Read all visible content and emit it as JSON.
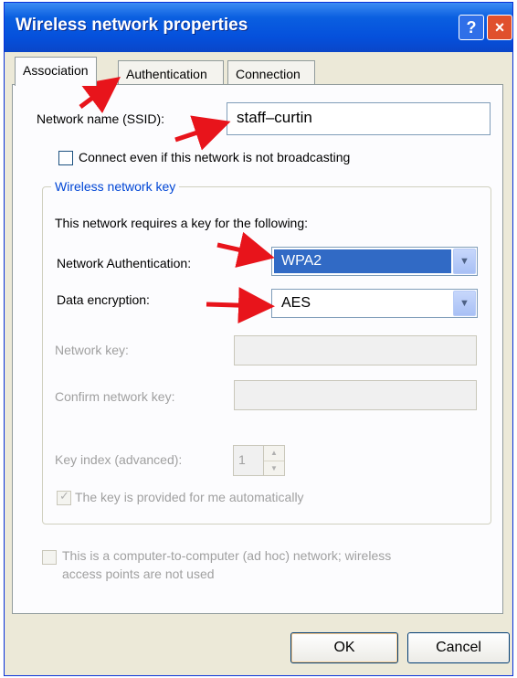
{
  "window": {
    "title": "Wireless network properties",
    "help_label": "?",
    "close_label": "×"
  },
  "tabs": [
    {
      "label": "Association",
      "active": true
    },
    {
      "label": "Authentication",
      "active": false
    },
    {
      "label": "Connection",
      "active": false
    }
  ],
  "association": {
    "ssid_label": "Network name (SSID):",
    "ssid_value": "staff–curtin",
    "broadcast_label": "Connect even if this network is not broadcasting",
    "broadcast_checked": false
  },
  "key_group": {
    "title": "Wireless network key",
    "intro": "This network requires a key for the following:",
    "auth_label": "Network Authentication:",
    "auth_value": "WPA2",
    "enc_label": "Data encryption:",
    "enc_value": "AES",
    "netkey_label": "Network key:",
    "confirm_label": "Confirm network key:",
    "keyindex_label": "Key index (advanced):",
    "keyindex_value": "1",
    "auto_label": "The key is provided for me automatically",
    "auto_checked": true
  },
  "adhoc": {
    "line1": "This is a computer-to-computer (ad hoc) network; wireless",
    "line2": "access points are not used"
  },
  "buttons": {
    "ok": "OK",
    "cancel": "Cancel"
  },
  "colors": {
    "titlebar": "#0550dc",
    "selection": "#316ac5",
    "annotation_arrow": "#e8141b",
    "group_title": "#0046d5"
  }
}
